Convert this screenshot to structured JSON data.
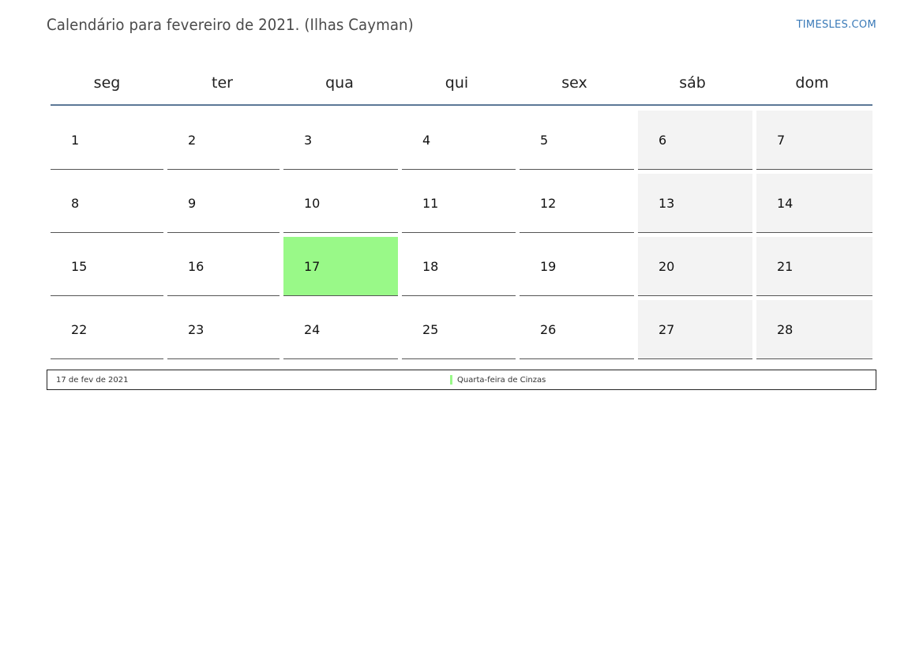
{
  "header": {
    "title": "Calendário para fevereiro de 2021. (Ilhas Cayman)",
    "brand": "TIMESLES.COM"
  },
  "weekdays": [
    "seg",
    "ter",
    "qua",
    "qui",
    "sex",
    "sáb",
    "dom"
  ],
  "weeks": [
    [
      "1",
      "2",
      "3",
      "4",
      "5",
      "6",
      "7"
    ],
    [
      "8",
      "9",
      "10",
      "11",
      "12",
      "13",
      "14"
    ],
    [
      "15",
      "16",
      "17",
      "18",
      "19",
      "20",
      "21"
    ],
    [
      "22",
      "23",
      "24",
      "25",
      "26",
      "27",
      "28"
    ]
  ],
  "weekend_color": "#f3f3f3",
  "holiday_color": "#99f988",
  "holidays": [
    {
      "day": "17",
      "date_label": "17 de fev de 2021",
      "name": "Quarta-feira de Cinzas"
    }
  ],
  "colors": {
    "title": "#4a4a4a",
    "brand": "#3a7ab8",
    "header_rule": "#5c7896"
  }
}
